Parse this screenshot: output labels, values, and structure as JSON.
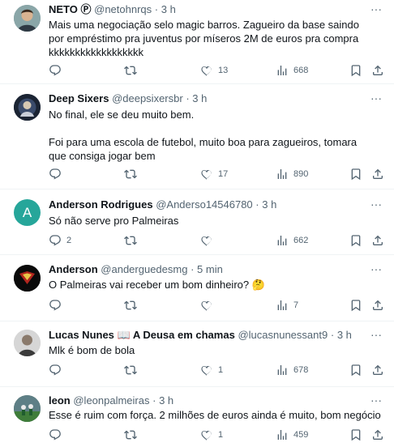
{
  "tweets": [
    {
      "name": "NETO Ⓟ",
      "handle": "@netohnrqs",
      "dot": "·",
      "time": "3 h",
      "text": "Mais uma negociação selo magic barros. Zagueiro da base saindo por empréstimo pra juventus por míseros 2M de euros pra compra kkkkkkkkkkkkkkkkkk",
      "replies": "",
      "retweets": "",
      "likes": "13",
      "views": "668"
    },
    {
      "name": "Deep Sixers",
      "handle": "@deepsixersbr",
      "dot": "·",
      "time": "3 h",
      "text": "No final, ele se deu muito bem.\n\nFoi para uma escola de futebol, muito boa para zagueiros, tomara que consiga jogar bem",
      "replies": "",
      "retweets": "",
      "likes": "17",
      "views": "890"
    },
    {
      "name": "Anderson Rodrigues",
      "handle": "@Anderso14546780",
      "dot": "·",
      "time": "3 h",
      "avatar_letter": "A",
      "text": "Só não serve pro Palmeiras",
      "replies": "2",
      "retweets": "",
      "likes": "",
      "views": "662"
    },
    {
      "name": "Anderson",
      "handle": "@anderguedesmg",
      "dot": "·",
      "time": "5 min",
      "text": "O Palmeiras vai receber um bom dinheiro? 🤔",
      "replies": "",
      "retweets": "",
      "likes": "",
      "views": "7"
    },
    {
      "name": "Lucas Nunes 📖 A Deusa em chamas",
      "handle": "@lucasnunessant9",
      "dot": "·",
      "time": "3 h",
      "text": "Mlk é bom de bola",
      "replies": "",
      "retweets": "",
      "likes": "1",
      "views": "678"
    },
    {
      "name": "leon",
      "handle": "@leonpalmeiras",
      "dot": "·",
      "time": "3 h",
      "text": "Esse é ruim com força. 2 milhões de euros ainda é muito, bom negócio",
      "replies": "",
      "retweets": "",
      "likes": "1",
      "views": "459"
    }
  ],
  "icons": {
    "more": "more-icon",
    "reply": "reply-icon",
    "retweet": "retweet-icon",
    "like": "like-icon",
    "views": "views-icon",
    "bookmark": "bookmark-icon",
    "share": "share-icon"
  },
  "colors": {
    "text": "#0f1419",
    "secondary": "#536471",
    "separator": "#eff3f4",
    "avatar_letter_bg": "#26a69a"
  }
}
